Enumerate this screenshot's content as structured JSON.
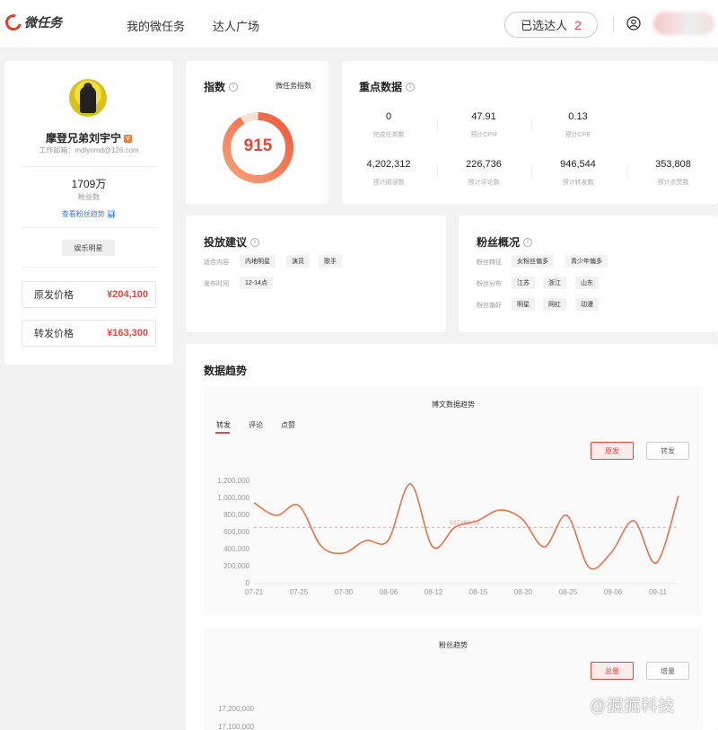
{
  "header": {
    "logo_text": "微任务",
    "nav": [
      "我的微任务",
      "达人广场"
    ],
    "selected_label": "已选达人",
    "selected_count": "2"
  },
  "profile": {
    "name": "摩登兄弟刘宇宁",
    "email": "工作邮箱：mdlynmd@126.com",
    "fans_value": "1709万",
    "fans_label": "粉丝数",
    "fans_link": "查看粉丝趋势",
    "tag": "娱乐明星",
    "prices": [
      {
        "label": "原发价格",
        "value": "¥204,100"
      },
      {
        "label": "转发价格",
        "value": "¥163,300"
      }
    ]
  },
  "index_card": {
    "title": "指数",
    "link": "微任务指数",
    "value": "915",
    "fill_ratio": 0.915
  },
  "key_data": {
    "title": "重点数据",
    "metrics": [
      {
        "value": "0",
        "label": "完成任务数"
      },
      {
        "value": "47.91",
        "label": "预计CPM"
      },
      {
        "value": "0.13",
        "label": "预计CPE"
      },
      {
        "value": "4,202,312",
        "label": "预计阅读数"
      },
      {
        "value": "226,736",
        "label": "预计评论数"
      },
      {
        "value": "946,544",
        "label": "预计转发数"
      },
      {
        "value": "353,808",
        "label": "预计点赞数"
      }
    ]
  },
  "advice": {
    "title": "投放建议",
    "rows": [
      {
        "label": "适合内容",
        "chips": [
          "内地明星",
          "演员",
          "歌手"
        ]
      },
      {
        "label": "发布时间",
        "chips": [
          "12-14点"
        ]
      }
    ]
  },
  "fans_overview": {
    "title": "粉丝概况",
    "rows": [
      {
        "label": "粉丝特征",
        "chips": [
          "女粉丝偏多",
          "青少年偏多"
        ]
      },
      {
        "label": "粉丝分布",
        "chips": [
          "江苏",
          "浙江",
          "山东"
        ]
      },
      {
        "label": "粉丝偏好",
        "chips": [
          "明星",
          "网红",
          "动漫"
        ]
      }
    ]
  },
  "trend": {
    "title": "数据趋势",
    "chart1_title": "博文数据趋势",
    "tabs": [
      "转发",
      "评论",
      "点赞"
    ],
    "btn_original": "原发",
    "btn_repost": "转发",
    "chart2_title": "粉丝趋势",
    "btn_total": "总量",
    "btn_increment": "增量",
    "chart2_yticks": [
      "17,200,000",
      "17,100,000"
    ]
  },
  "chart_data": {
    "type": "line",
    "x_ticks": [
      "07-21",
      "07-25",
      "07-30",
      "08-06",
      "08-12",
      "08-15",
      "08-20",
      "08-25",
      "09-06",
      "09-11"
    ],
    "y_ticks": [
      "1,200,000",
      "1,000,000",
      "800,000",
      "600,000",
      "400,000",
      "200,000",
      "0"
    ],
    "ylim": [
      0,
      1200000
    ],
    "x": [
      0,
      1,
      2,
      3,
      4,
      5,
      6,
      7,
      8,
      9,
      10,
      11,
      12,
      13,
      14,
      15,
      16,
      17,
      18,
      19,
      20,
      21,
      22,
      23,
      24,
      25,
      26
    ],
    "values": [
      900000,
      760000,
      870000,
      420000,
      340000,
      480000,
      480000,
      1110000,
      410000,
      630000,
      700000,
      820000,
      720000,
      410000,
      760000,
      180000,
      350000,
      700000,
      230000,
      980000
    ],
    "average": 627490.59,
    "average_label": "627490.59",
    "color": "#e8724a"
  },
  "watermark": "@掘掘科技"
}
